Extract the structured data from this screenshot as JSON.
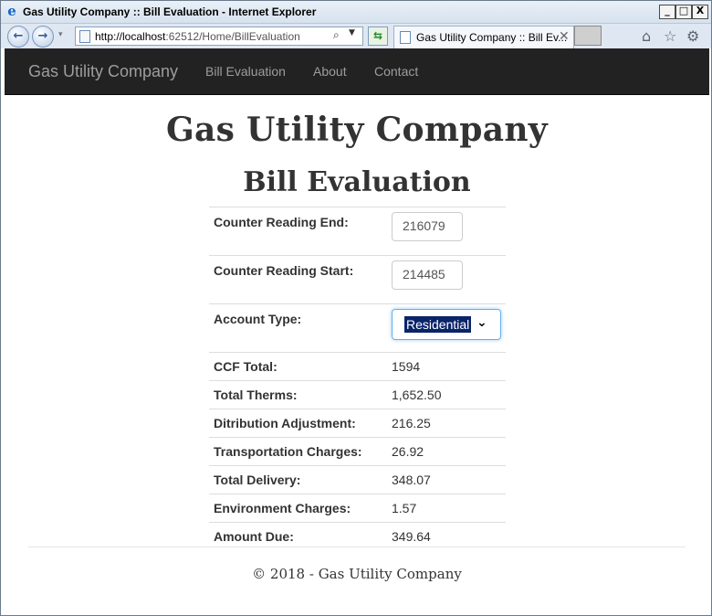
{
  "window": {
    "title": "Gas Utility Company :: Bill Evaluation - Internet Explorer",
    "controls": {
      "minimize": "_",
      "maximize": "□",
      "close": "X"
    }
  },
  "browser": {
    "address": {
      "host": "http://localhost",
      "rest": ":62512/Home/BillEvaluation"
    },
    "tab_title": "Gas Utility Company :: Bill Ev...",
    "icons": [
      "back-icon",
      "forward-icon",
      "home-icon",
      "favorites-star-icon",
      "settings-gear-icon"
    ]
  },
  "navbar": {
    "brand": "Gas Utility Company",
    "links": [
      "Bill Evaluation",
      "About",
      "Contact"
    ]
  },
  "page": {
    "heading": "Gas Utility Company",
    "subheading": "Bill Evaluation"
  },
  "form": {
    "counter_end": {
      "label": "Counter Reading End:",
      "value": "216079"
    },
    "counter_start": {
      "label": "Counter Reading Start:",
      "value": "214485"
    },
    "account_type": {
      "label": "Account Type:",
      "selected": "Residential"
    }
  },
  "results": [
    {
      "label": "CCF Total:",
      "value": "1594"
    },
    {
      "label": "Total Therms:",
      "value": "1,652.50"
    },
    {
      "label": "Ditribution Adjustment:",
      "value": "216.25"
    },
    {
      "label": "Transportation Charges:",
      "value": "26.92"
    },
    {
      "label": "Total Delivery:",
      "value": "348.07"
    },
    {
      "label": "Environment Charges:",
      "value": "1.57"
    },
    {
      "label": "Amount Due:",
      "value": "349.64"
    }
  ],
  "footer": {
    "text": "© 2018 - Gas Utility Company"
  },
  "colors": {
    "navbar_bg": "#222222",
    "nav_text": "#9d9d9d",
    "heading": "#333333",
    "focus_border": "#66afe9",
    "selection_bg": "#0a246a"
  }
}
